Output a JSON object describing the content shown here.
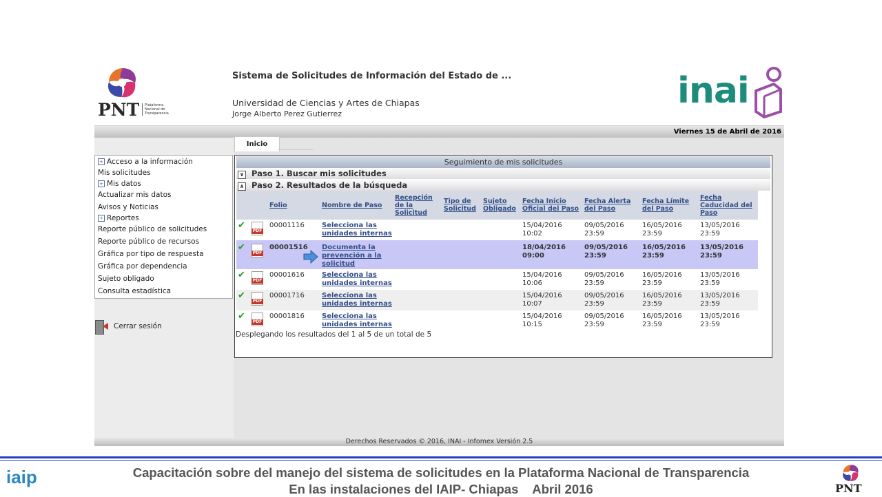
{
  "header": {
    "pnt_logo_text": "PNT",
    "pnt_logo_sub": "Plataforma Nacional de Transparencia",
    "system_title": "Sistema de Solicitudes de Información del Estado de ...",
    "institution": "Universidad de Ciencias y Artes de Chiapas",
    "user": "Jorge Alberto Perez Gutierrez",
    "inai_logo_text": "inai",
    "date": "Viernes 15 de Abril de 2016"
  },
  "tabs": [
    {
      "label": "Inicio",
      "active": true
    }
  ],
  "sidebar": {
    "items": [
      {
        "label": "Acceso a la información",
        "expandable": true
      },
      {
        "label": "Mis solicitudes",
        "expandable": false
      },
      {
        "label": "Mis datos",
        "expandable": true
      },
      {
        "label": "Actualizar mis datos",
        "expandable": false
      },
      {
        "label": "Avisos y Noticias",
        "expandable": false
      },
      {
        "label": "Reportes",
        "expandable": true
      },
      {
        "label": "Reporte público de solicitudes",
        "expandable": false
      },
      {
        "label": "Reporte público de recursos",
        "expandable": false
      },
      {
        "label": "Gráfica por tipo de respuesta",
        "expandable": false
      },
      {
        "label": "Gráfica por dependencia",
        "expandable": false
      },
      {
        "label": "Sujeto obligado",
        "expandable": false
      },
      {
        "label": "Consulta estadística",
        "expandable": false
      }
    ],
    "logout": "Cerrar sesión"
  },
  "panel": {
    "title": "Seguimiento de mis solicitudes",
    "step1": "Paso 1. Buscar mis solicitudes",
    "step2": "Paso 2. Resultados de la búsqueda",
    "columns": [
      "Folio",
      "Nombre de Paso",
      "Recepción de la Solicitud",
      "Tipo de Solicitud",
      "Sujeto Obligado",
      "Fecha Inicio Oficial del Paso",
      "Fecha Alerta del Paso",
      "Fecha Límite del Paso",
      "Fecha Caducidad del Paso"
    ],
    "rows": [
      {
        "folio": "00001116",
        "paso": "Selecciona las unidades internas",
        "recepcion": "",
        "tipo": "",
        "sujeto": "",
        "inicio": "15/04/2016 10:02",
        "alerta": "09/05/2016 23:59",
        "limite": "16/05/2016 23:59",
        "caducidad": "13/05/2016 23:59"
      },
      {
        "folio": "00001516",
        "paso": "Documenta la prevención a la solicitud",
        "recepcion": "",
        "tipo": "",
        "sujeto": "",
        "inicio": "18/04/2016 09:00",
        "alerta": "09/05/2016 23:59",
        "limite": "16/05/2016 23:59",
        "caducidad": "13/05/2016 23:59"
      },
      {
        "folio": "00001616",
        "paso": "Selecciona las unidades internas",
        "recepcion": "",
        "tipo": "",
        "sujeto": "",
        "inicio": "15/04/2016 10:06",
        "alerta": "09/05/2016 23:59",
        "limite": "16/05/2016 23:59",
        "caducidad": "13/05/2016 23:59"
      },
      {
        "folio": "00001716",
        "paso": "Selecciona las unidades internas",
        "recepcion": "",
        "tipo": "",
        "sujeto": "",
        "inicio": "15/04/2016 10:07",
        "alerta": "09/05/2016 23:59",
        "limite": "16/05/2016 23:59",
        "caducidad": "13/05/2016 23:59"
      },
      {
        "folio": "00001816",
        "paso": "Selecciona las unidades internas",
        "recepcion": "",
        "tipo": "",
        "sujeto": "",
        "inicio": "15/04/2016 10:15",
        "alerta": "09/05/2016 23:59",
        "limite": "16/05/2016 23:59",
        "caducidad": "13/05/2016 23:59"
      }
    ],
    "summary": "Desplegando los resultados del 1 al 5 de un total de 5",
    "pdf_label": "PDF"
  },
  "footer": {
    "copyright": "Derechos Reservados © 2016, INAI - Infomex Versión 2.5"
  },
  "slide": {
    "caption1": "Capacitación sobre del manejo del sistema de solicitudes en la Plataforma Nacional de Transparencia",
    "caption2": "En las instalaciones del IAIP- Chiapas    Abril 2016",
    "iaip_logo_text": "iaip",
    "pnt_logo_text": "PNT"
  },
  "colors": {
    "accent_link": "#334f8a",
    "highlight_row": "#c8c7f6",
    "inai_green": "#1e8c7c",
    "slide_rule": "#1f3fbf"
  }
}
